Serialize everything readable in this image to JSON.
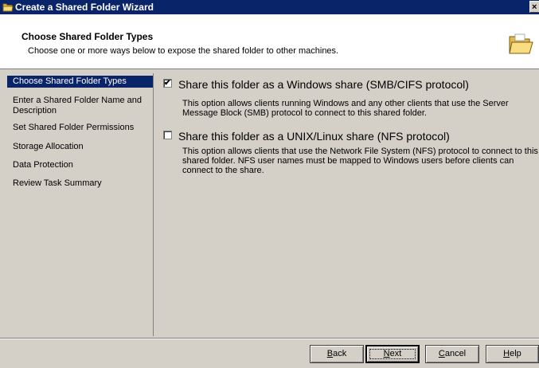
{
  "window": {
    "title": "Create a Shared Folder Wizard",
    "close_label": "×",
    "icon": "folder-icon"
  },
  "header": {
    "title": "Choose Shared Folder Types",
    "subtitle": "Choose one or more ways below to expose the shared folder to other machines.",
    "icon": "folder-icon"
  },
  "nav": {
    "items": [
      {
        "label": "Choose Shared Folder Types",
        "selected": true
      },
      {
        "label": "Enter a Shared Folder Name and Description",
        "selected": false
      },
      {
        "label": "Set Shared Folder Permissions",
        "selected": false
      },
      {
        "label": "Storage Allocation",
        "selected": false
      },
      {
        "label": "Data Protection",
        "selected": false
      },
      {
        "label": "Review Task Summary",
        "selected": false
      }
    ]
  },
  "options": [
    {
      "title": "Share this folder as a Windows share (SMB/CIFS protocol)",
      "description": "This option allows clients running Windows and any other clients that use the Server Message Block (SMB) protocol to connect to this shared folder.",
      "checked": true
    },
    {
      "title": "Share this folder as a UNIX/Linux share (NFS protocol)",
      "description": "This option allows clients that use the Network File System (NFS) protocol to connect to this shared folder.  NFS user names must be mapped to Windows users before clients can connect to the share.",
      "checked": false
    }
  ],
  "buttons": {
    "back": {
      "underline": "B",
      "rest": "ack"
    },
    "next": {
      "underline": "N",
      "rest": "ext"
    },
    "cancel": {
      "underline": "C",
      "rest": "ancel"
    },
    "help": {
      "underline": "H",
      "rest": "elp"
    }
  },
  "colors": {
    "titlebar": "#0a246a",
    "selection": "#0a246a",
    "face": "#d4d0c8"
  }
}
